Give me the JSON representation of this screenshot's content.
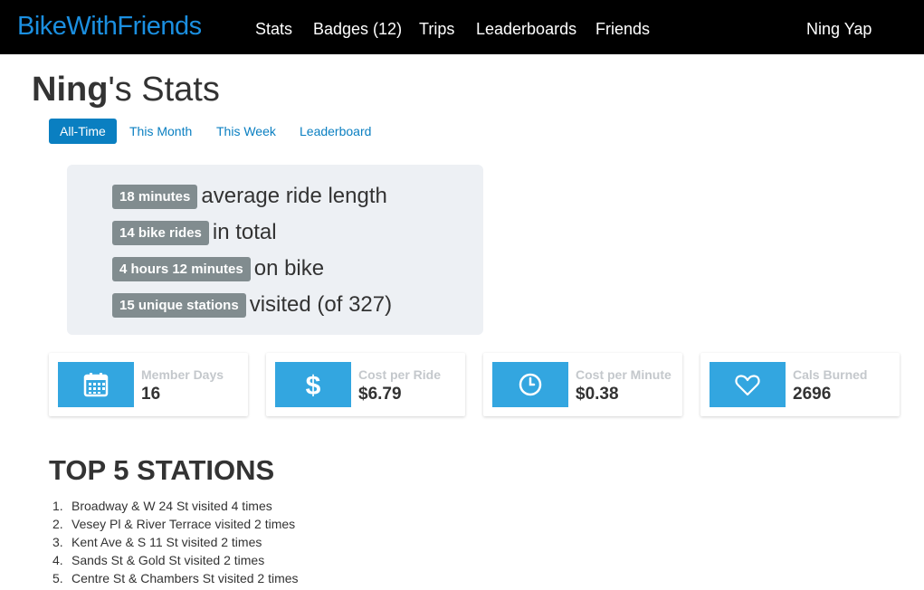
{
  "nav": {
    "brand": "BikeWithFriends",
    "items": [
      "Stats",
      "Badges (12)",
      "Trips",
      "Leaderboards",
      "Friends"
    ],
    "user": "Ning Yap"
  },
  "page": {
    "title_name": "Ning",
    "title_suffix": "'s Stats"
  },
  "tabs": [
    "All-Time",
    "This Month",
    "This Week",
    "Leaderboard"
  ],
  "active_tab": "All-Time",
  "summary": [
    {
      "badge": "18 minutes",
      "text": "average ride length"
    },
    {
      "badge": "14 bike rides",
      "text": "in total"
    },
    {
      "badge": "4 hours 12 minutes",
      "text": "on bike"
    },
    {
      "badge": "15 unique stations",
      "text": "visited (of 327)"
    }
  ],
  "cards": [
    {
      "icon": "calendar-icon",
      "label": "Member Days",
      "value": "16"
    },
    {
      "icon": "dollar-icon",
      "label": "Cost per Ride",
      "value": "$6.79"
    },
    {
      "icon": "clock-icon",
      "label": "Cost per Minute",
      "value": "$0.38"
    },
    {
      "icon": "heart-icon",
      "label": "Cals Burned",
      "value": "2696"
    }
  ],
  "top_stations": {
    "title": "TOP 5 STATIONS",
    "items": [
      {
        "num": "1.",
        "text": "Broadway & W 24 St visited 4 times"
      },
      {
        "num": "2.",
        "text": "Vesey Pl & River Terrace visited 2 times"
      },
      {
        "num": "3.",
        "text": "Kent Ave & S 11 St visited 2 times"
      },
      {
        "num": "4.",
        "text": "Sands St & Gold St visited 2 times"
      },
      {
        "num": "5.",
        "text": "Centre St & Chambers St visited 2 times"
      }
    ]
  },
  "colors": {
    "brand": "#1b8fe0",
    "accent": "#0a7fc1",
    "icon_box": "#33a6e0",
    "badge": "#818c8f",
    "summary_bg": "#edf0f4"
  }
}
